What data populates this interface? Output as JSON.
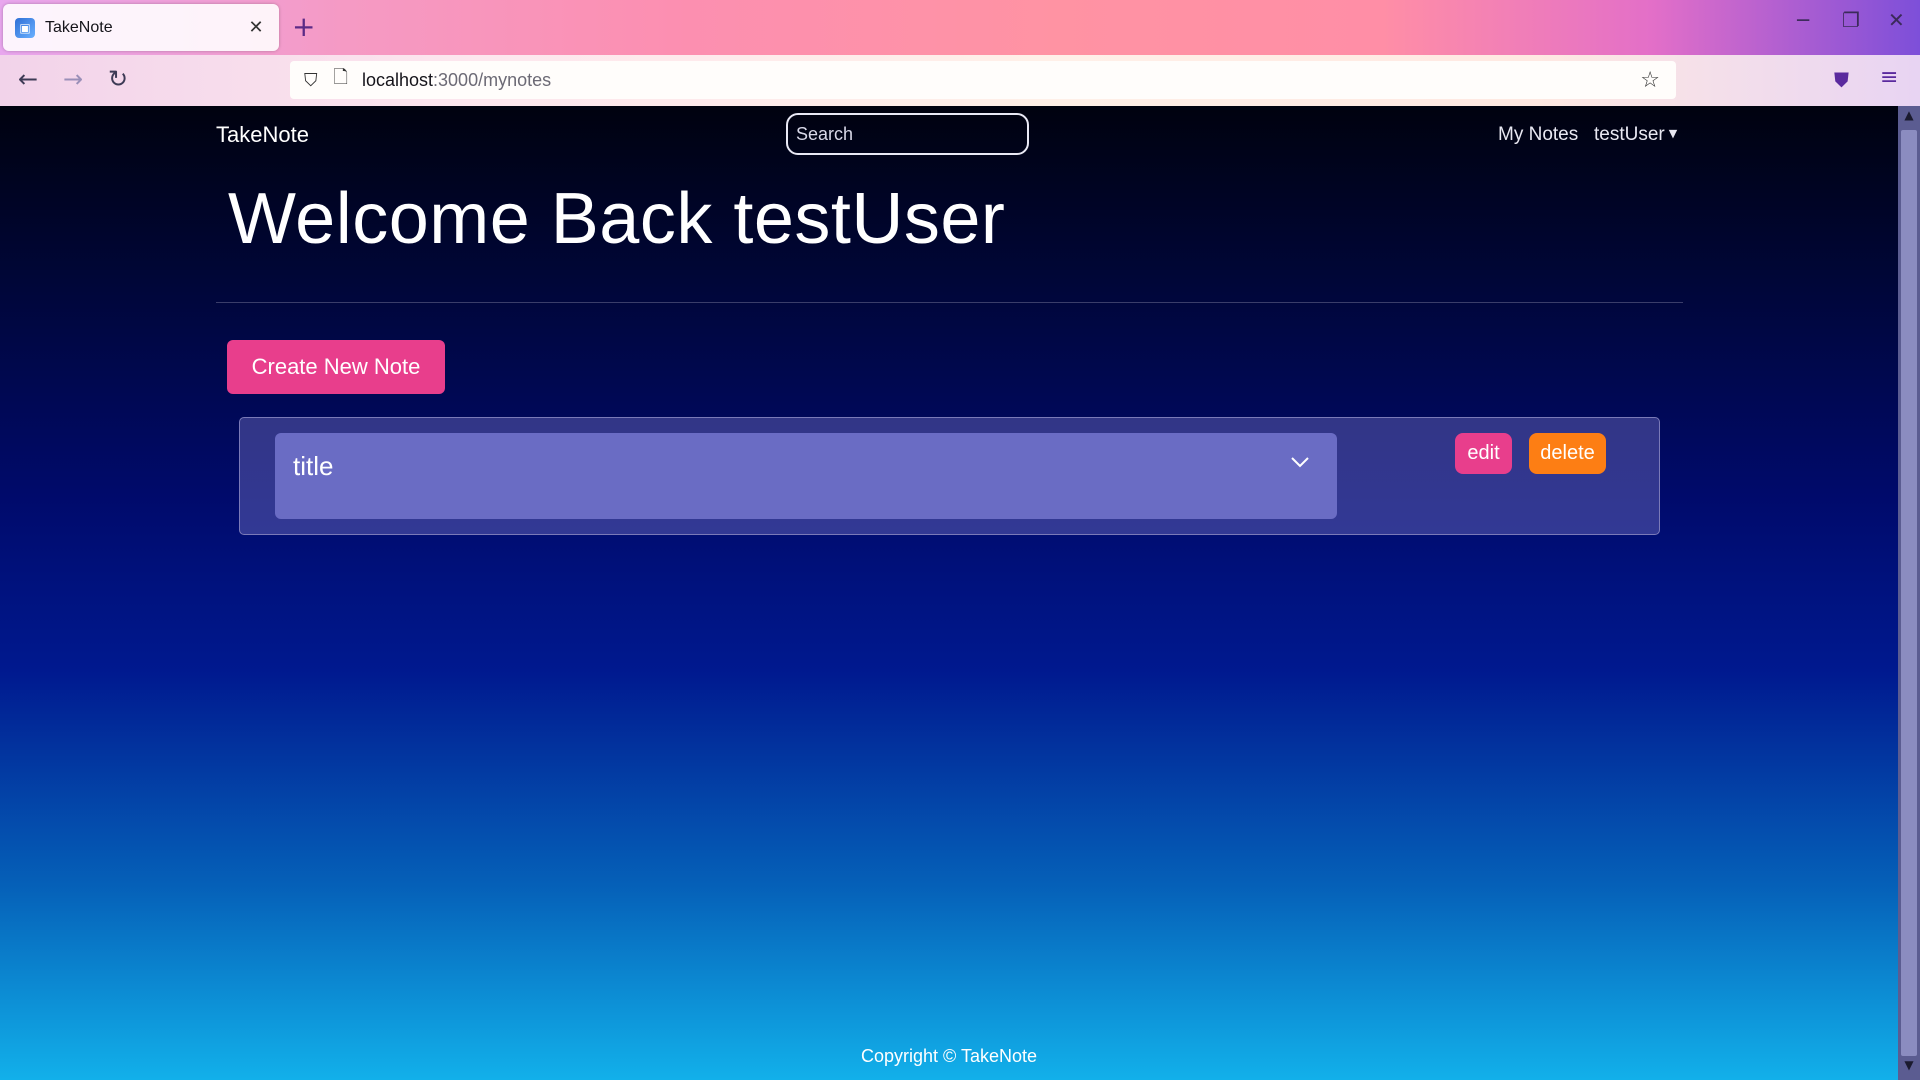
{
  "browser": {
    "tab_title": "TakeNote",
    "tab_close": "✕",
    "new_tab": "+",
    "favicon": "🖥",
    "url_host": "localhost",
    "url_path": ":3000/mynotes",
    "icons": {
      "back": "back-arrow-icon",
      "forward": "forward-arrow-icon",
      "reload": "reload-icon",
      "shield": "shield-icon",
      "page": "page-icon",
      "star": "star-icon",
      "pocket": "pocket-icon",
      "menu": "hamburger-menu-icon",
      "minimize": "minimize-icon",
      "restore": "restore-icon",
      "close": "close-icon"
    }
  },
  "navbar": {
    "brand": "TakeNote",
    "search_placeholder": "Search",
    "my_notes": "My Notes",
    "user": "testUser"
  },
  "main": {
    "welcome": "Welcome Back testUser",
    "create_button": "Create New Note",
    "notes": [
      {
        "title": "title",
        "edit_label": "edit",
        "delete_label": "delete"
      }
    ]
  },
  "footer": {
    "text": "Copyright © TakeNote"
  },
  "colors": {
    "accent_pink": "#e83e8c",
    "accent_orange": "#fd7e14",
    "accordion_bg": "#6a6cc4"
  }
}
